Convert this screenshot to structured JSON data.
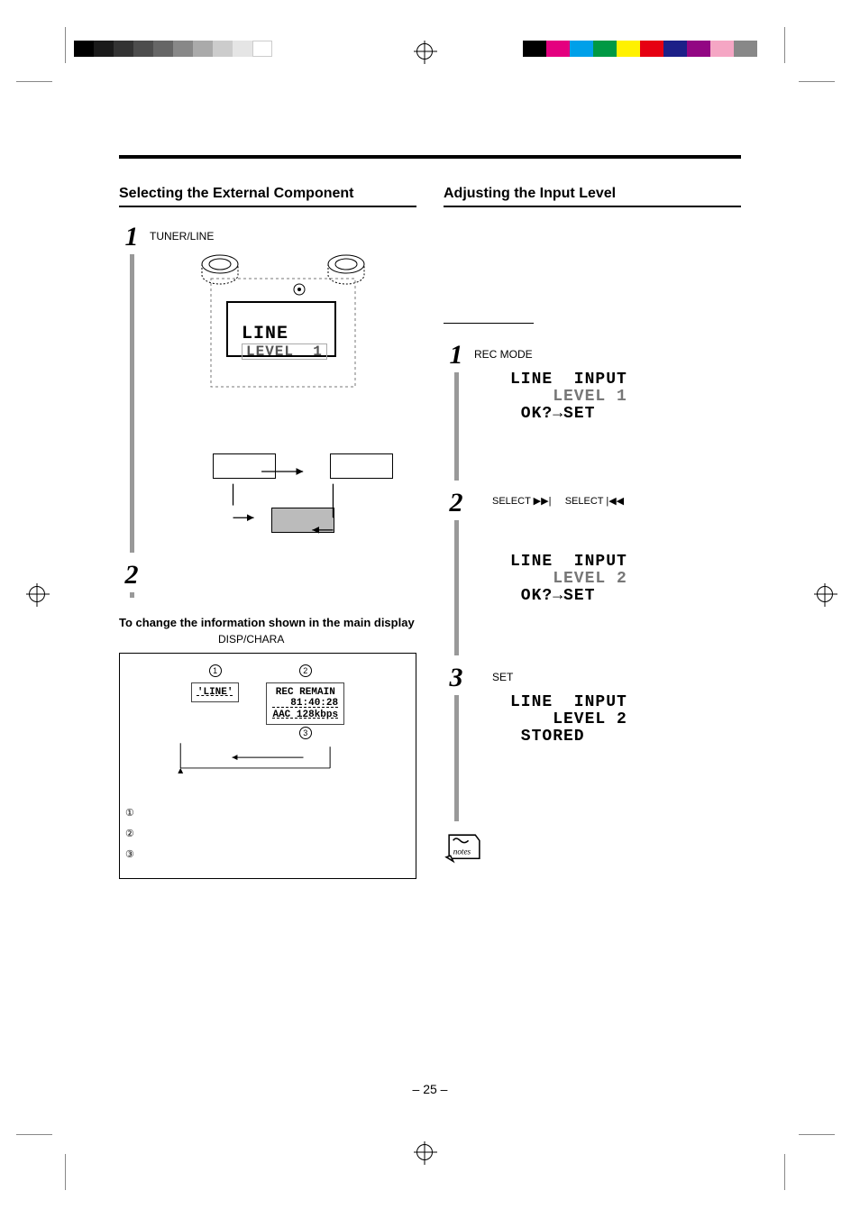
{
  "page_number": "– 25 –",
  "left": {
    "heading": "Selecting the External Component",
    "step1_label": "TUNER/LINE",
    "device_lcd_line1": "LINE",
    "device_lcd_line2": "LEVEL  1",
    "subhead": "To change the information shown in the main display",
    "subhead_label": "DISP/CHARA",
    "mini1_circ": "1",
    "mini1_text": "'LINE'",
    "mini2_circ": "2",
    "mini2_line1": "REC REMAIN",
    "mini2_line2": "   81:40:28",
    "mini2_line3": "AAC 128kbps",
    "mini2_circ3": "3",
    "annot1": "①",
    "annot2": "②",
    "annot3": "③"
  },
  "right": {
    "heading": "Adjusting the Input Level",
    "step1_label": "REC MODE",
    "lcd1_line1": "LINE  INPUT",
    "lcd1_line2": "    LEVEL 1 ",
    "lcd1_line3": " OK?→SET",
    "step2_label_a": "SELECT ▶▶|",
    "step2_label_b": "SELECT |◀◀",
    "lcd2_line1": "LINE  INPUT",
    "lcd2_line2": "    LEVEL 2 ",
    "lcd2_line3": " OK?→SET",
    "step3_label": "SET",
    "lcd3_line1": "LINE  INPUT",
    "lcd3_line2": "    LEVEL 2",
    "lcd3_line3": " STORED",
    "notes_label": "notes"
  }
}
